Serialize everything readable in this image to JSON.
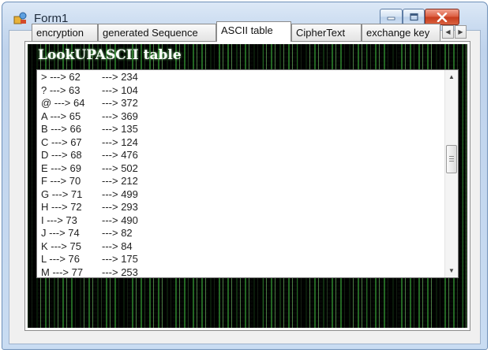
{
  "window": {
    "title": "Form1",
    "icon": "app-form-icon"
  },
  "controls": {
    "minimize": "minimize-icon",
    "maximize": "maximize-icon",
    "close": "close-icon"
  },
  "tabs": [
    {
      "label": "encryption"
    },
    {
      "label": "generated Sequence"
    },
    {
      "label": "ASCII table",
      "active": true
    },
    {
      "label": "CipherText"
    },
    {
      "label": "exchange key"
    }
  ],
  "tab_page": {
    "title": "LookUPASCII table",
    "rows": [
      {
        "code": "> ---> 62",
        "value": "---> 234"
      },
      {
        "code": "? ---> 63",
        "value": "---> 104"
      },
      {
        "code": "@ ---> 64",
        "value": "---> 372"
      },
      {
        "code": "A ---> 65",
        "value": "---> 369"
      },
      {
        "code": "B ---> 66",
        "value": "---> 135"
      },
      {
        "code": "C ---> 67",
        "value": "---> 124"
      },
      {
        "code": "D ---> 68",
        "value": "---> 476"
      },
      {
        "code": "E ---> 69",
        "value": "---> 502"
      },
      {
        "code": "F ---> 70",
        "value": "---> 212"
      },
      {
        "code": "G ---> 71",
        "value": "---> 499"
      },
      {
        "code": "H ---> 72",
        "value": "---> 293"
      },
      {
        "code": "I ---> 73",
        "value": "---> 490"
      },
      {
        "code": "J ---> 74",
        "value": "---> 82"
      },
      {
        "code": "K ---> 75",
        "value": "---> 84"
      },
      {
        "code": "L ---> 76",
        "value": "---> 175"
      },
      {
        "code": "M ---> 77",
        "value": "---> 253"
      }
    ]
  },
  "colors": {
    "matrix_green": "#3f9a3f",
    "window_frame": "#6d8fb8",
    "close_red": "#c73c1d"
  }
}
